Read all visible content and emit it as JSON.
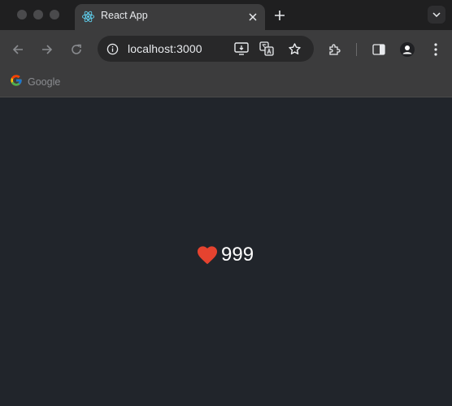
{
  "browser": {
    "tab": {
      "title": "React App",
      "favicon": "react-icon"
    },
    "new_tab_icon": "plus-icon",
    "address": {
      "url": "localhost:3000"
    },
    "bookmarks": [
      {
        "label": "Google",
        "icon": "google-icon"
      }
    ]
  },
  "app": {
    "likes": 999,
    "heart_color": "#e5432f"
  }
}
